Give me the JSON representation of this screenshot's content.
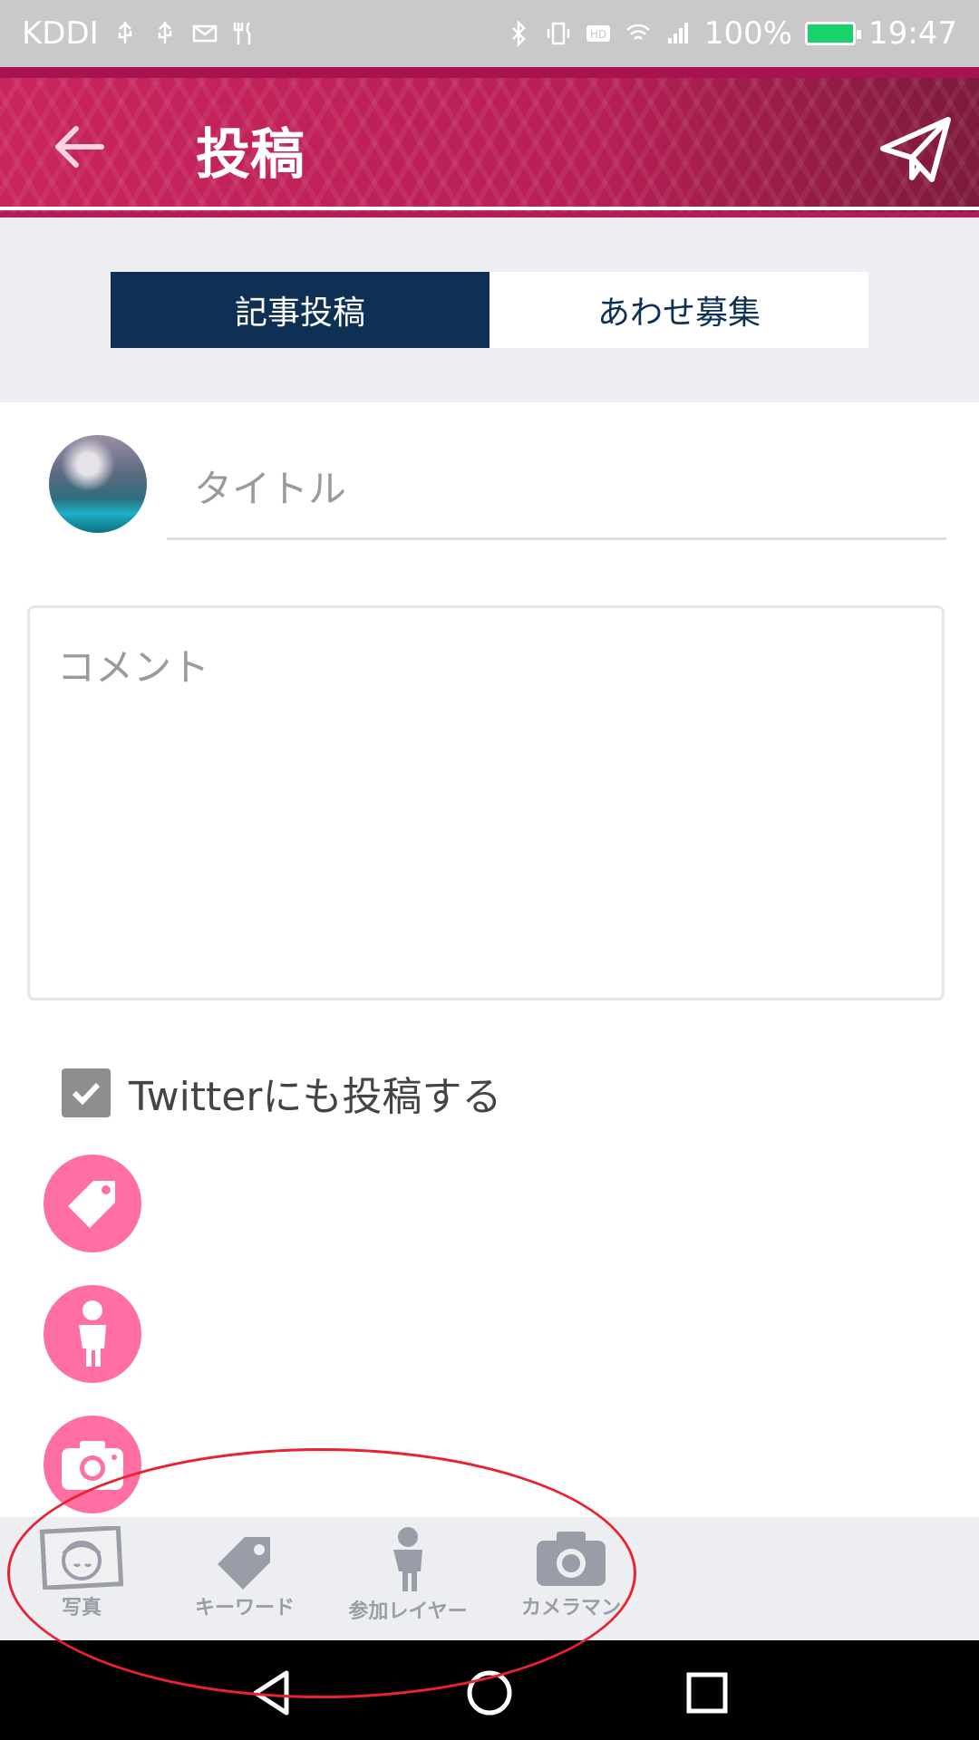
{
  "status_bar": {
    "carrier": "KDDI",
    "battery_percent": "100%",
    "time": "19:47",
    "left_icons": [
      "usb-icon",
      "usb-icon",
      "mail-icon",
      "restaurant-icon"
    ],
    "right_icons": [
      "bluetooth-icon",
      "vibrate-icon",
      "hd-icon",
      "wifi-icon",
      "signal-icon",
      "battery-icon"
    ]
  },
  "header": {
    "title": "投稿",
    "back_icon": "arrow-left-icon",
    "send_icon": "send-icon",
    "color": "#c9245e"
  },
  "segments": {
    "items": [
      {
        "label": "記事投稿",
        "active": true
      },
      {
        "label": "あわせ募集",
        "active": false
      }
    ],
    "active_color": "#0d3054"
  },
  "form": {
    "title_placeholder": "タイトル",
    "comment_placeholder": "コメント",
    "twitter_label": "Twitterにも投稿する",
    "twitter_checked": true
  },
  "action_icons": [
    "tag-icon",
    "person-icon",
    "camera-icon"
  ],
  "toolbar": {
    "items": [
      {
        "label": "写真",
        "icon": "photo-icon"
      },
      {
        "label": "キーワード",
        "icon": "tag-icon"
      },
      {
        "label": "参加レイヤー",
        "icon": "person-icon"
      },
      {
        "label": "カメラマン",
        "icon": "camera-icon"
      }
    ]
  },
  "nav_bar": [
    "back-triangle-icon",
    "home-circle-icon",
    "recents-square-icon"
  ],
  "colors": {
    "pink": "#ff6fa3",
    "annotation": "#e8232f"
  }
}
